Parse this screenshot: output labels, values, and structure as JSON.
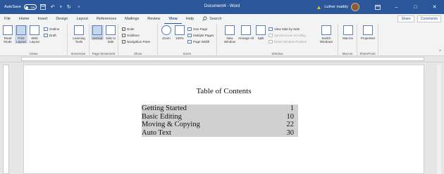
{
  "titlebar": {
    "autosave_label": "AutoSave",
    "autosave_state": "Off",
    "doc_title": "Document4 - Word",
    "user_name": "Luther maddy",
    "minimize": "–",
    "restore": "□",
    "close": "✕"
  },
  "tabs": [
    "File",
    "Home",
    "Insert",
    "Design",
    "Layout",
    "References",
    "Mailings",
    "Review",
    "View",
    "Help"
  ],
  "active_tab": "View",
  "search_label": "Search",
  "share_label": "Share",
  "comments_label": "Comments",
  "ribbon": {
    "views": {
      "label": "Views",
      "read_mode": "Read Mode",
      "print_layout": "Print Layout",
      "web_layout": "Web Layout",
      "outline": "Outline",
      "draft": "Draft"
    },
    "immersive": {
      "label": "Immersive",
      "learning_tools": "Learning Tools"
    },
    "page_movement": {
      "label": "Page Movement",
      "vertical": "Vertical",
      "side_to_side": "Side to Side"
    },
    "show": {
      "label": "Show",
      "ruler": "Ruler",
      "gridlines": "Gridlines",
      "navigation_pane": "Navigation Pane"
    },
    "zoom": {
      "label": "Zoom",
      "zoom": "Zoom",
      "hundred": "100%",
      "one_page": "One Page",
      "multiple_pages": "Multiple Pages",
      "page_width": "Page Width"
    },
    "window": {
      "label": "Window",
      "new_window": "New Window",
      "arrange_all": "Arrange All",
      "split": "Split",
      "view_side_by_side": "View Side by Side",
      "sync_scrolling": "Synchronous Scrolling",
      "reset_position": "Reset Window Position",
      "switch_windows": "Switch Windows"
    },
    "macros": {
      "label": "Macros",
      "macros": "Macros"
    },
    "sharepoint": {
      "label": "SharePoint",
      "properties": "Properties"
    }
  },
  "document": {
    "heading": "Table of Contents",
    "toc": [
      {
        "title": "Getting Started",
        "page": "1"
      },
      {
        "title": "Basic Editing",
        "page": "10"
      },
      {
        "title": "Moving & Copying",
        "page": "22"
      },
      {
        "title": "Auto Text",
        "page": "30"
      }
    ]
  },
  "colors": {
    "titlebar": "#2b579a",
    "toc_highlight": "#d0d0d0"
  }
}
